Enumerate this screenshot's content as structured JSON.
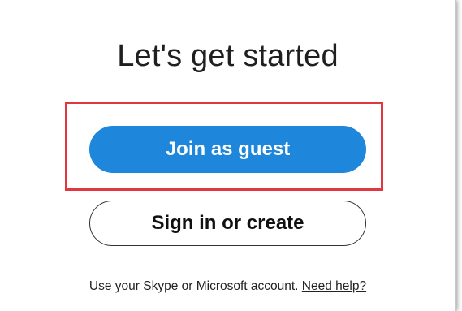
{
  "title": "Let's get started",
  "buttons": {
    "join_guest": "Join as guest",
    "sign_in": "Sign in or create"
  },
  "footer": {
    "text": "Use your Skype or Microsoft account.",
    "link": "Need help?"
  },
  "colors": {
    "primary_button": "#1e87dc",
    "highlight_border": "#e3373f"
  }
}
